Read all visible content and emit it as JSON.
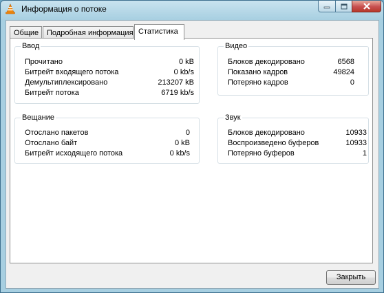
{
  "window": {
    "title": "Информация о потоке"
  },
  "tabs": [
    {
      "label": "Общие"
    },
    {
      "label": "Подробная информация"
    },
    {
      "label": "Статистика"
    }
  ],
  "input": {
    "title": "Ввод",
    "rows": [
      {
        "label": "Прочитано",
        "value": "0 kB"
      },
      {
        "label": "Битрейт входящего потока",
        "value": "0 kb/s"
      },
      {
        "label": "Демультиплексировано",
        "value": "213207 kB"
      },
      {
        "label": "Битрейт потока",
        "value": "6719 kb/s"
      }
    ]
  },
  "video": {
    "title": "Видео",
    "rows": [
      {
        "label": "Блоков декодировано",
        "value": "6568"
      },
      {
        "label": "Показано кадров",
        "value": "49824"
      },
      {
        "label": "Потеряно кадров",
        "value": "0"
      }
    ]
  },
  "streaming": {
    "title": "Вещание",
    "rows": [
      {
        "label": "Отослано пакетов",
        "value": "0"
      },
      {
        "label": "Отослано байт",
        "value": "0 kB"
      },
      {
        "label": "Битрейт исходящего потока",
        "value": "0 kb/s"
      }
    ]
  },
  "audio": {
    "title": "Звук",
    "rows": [
      {
        "label": "Блоков декодировано",
        "value": "10933"
      },
      {
        "label": "Воспроизведено буферов",
        "value": "10933"
      },
      {
        "label": "Потеряно буферов",
        "value": "1"
      }
    ]
  },
  "buttons": {
    "close": "Закрыть"
  },
  "icons": {
    "app": "vlc-cone-icon",
    "minimize": "minimize-icon",
    "maximize": "maximize-icon",
    "close": "close-x-icon"
  }
}
